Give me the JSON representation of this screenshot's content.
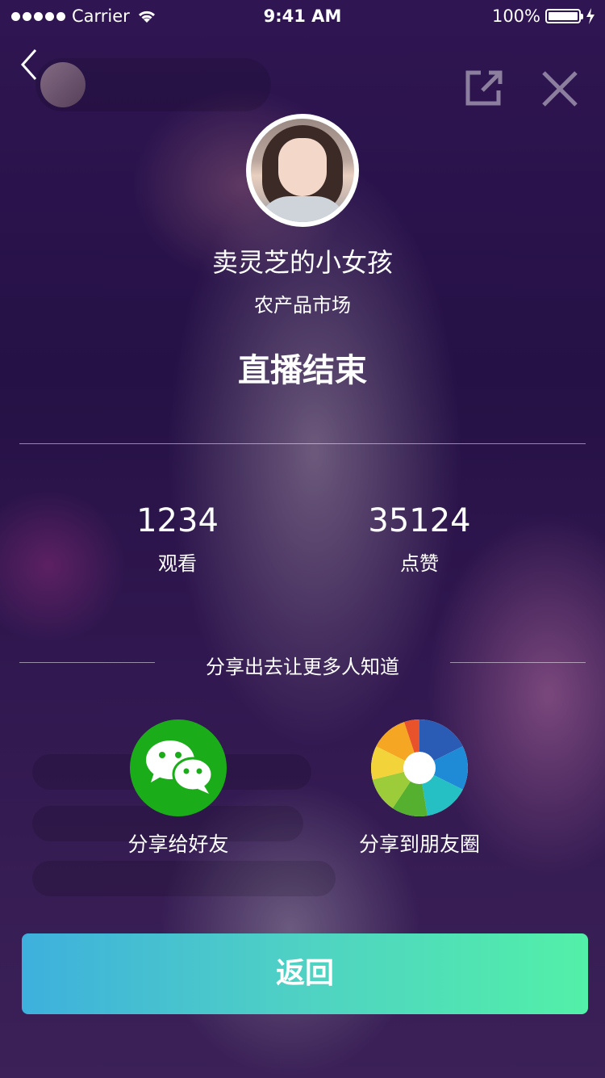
{
  "status_bar": {
    "carrier": "Carrier",
    "time": "9:41 AM",
    "battery": "100%"
  },
  "streamer": {
    "name": "卖灵芝的小女孩",
    "category": "农产品市场"
  },
  "live_status": "直播结束",
  "stats": [
    {
      "value": "1234",
      "label": "观看"
    },
    {
      "value": "35124",
      "label": "点赞"
    }
  ],
  "share": {
    "title": "分享出去让更多人知道",
    "wechat_label": "分享给好友",
    "moments_label": "分享到朋友圈"
  },
  "return_label": "返回",
  "colors": {
    "wechat": "#1aad19",
    "return_start": "#3eb0dd",
    "return_end": "#52f0a8"
  }
}
